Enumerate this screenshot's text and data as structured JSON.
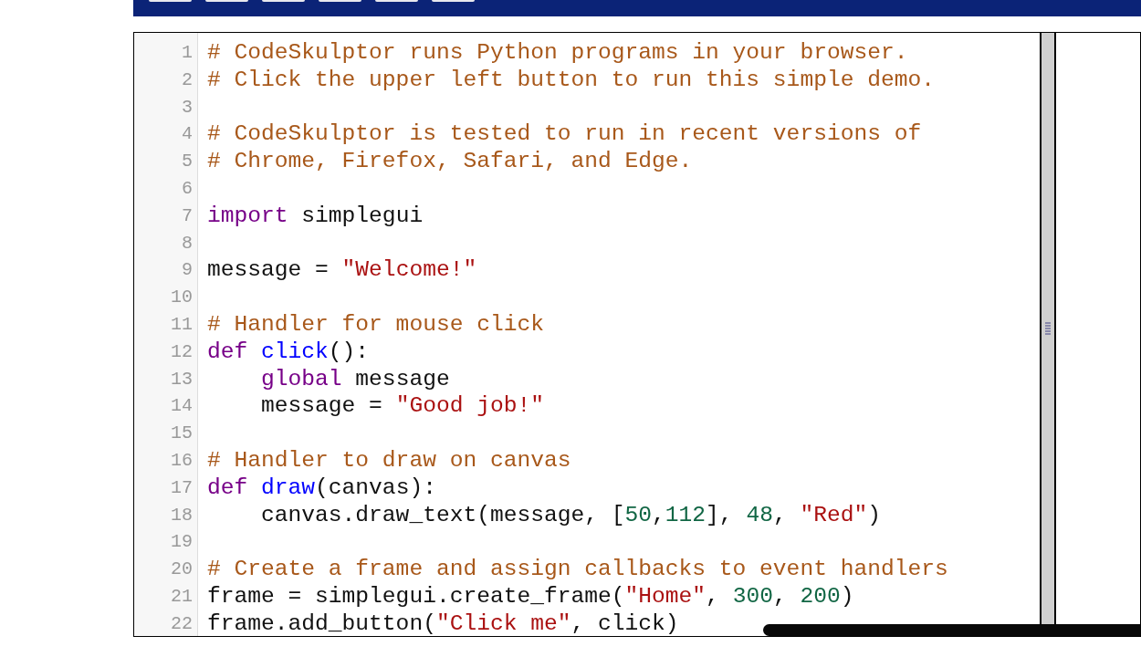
{
  "editor": {
    "lines": [
      {
        "n": "1",
        "tokens": [
          {
            "kind": "comment",
            "text": "# CodeSkulptor runs Python programs in your browser."
          }
        ]
      },
      {
        "n": "2",
        "tokens": [
          {
            "kind": "comment",
            "text": "# Click the upper left button to run this simple demo."
          }
        ]
      },
      {
        "n": "3"
      },
      {
        "n": "4",
        "tokens": [
          {
            "kind": "comment",
            "text": "# CodeSkulptor is tested to run in recent versions of"
          }
        ]
      },
      {
        "n": "5",
        "tokens": [
          {
            "kind": "comment",
            "text": "# Chrome, Firefox, Safari, and Edge."
          }
        ]
      },
      {
        "n": "6"
      },
      {
        "n": "7",
        "tokens": [
          {
            "kind": "keyword",
            "text": "import"
          },
          {
            "kind": "plain",
            "text": " simplegui"
          }
        ]
      },
      {
        "n": "8"
      },
      {
        "n": "9",
        "tokens": [
          {
            "kind": "plain",
            "text": "message = "
          },
          {
            "kind": "string",
            "text": "\"Welcome!\""
          }
        ]
      },
      {
        "n": "10"
      },
      {
        "n": "11",
        "tokens": [
          {
            "kind": "comment",
            "text": "# Handler for mouse click"
          }
        ]
      },
      {
        "n": "12",
        "tokens": [
          {
            "kind": "keyword",
            "text": "def"
          },
          {
            "kind": "def",
            "text": " click"
          },
          {
            "kind": "plain",
            "text": "():"
          }
        ]
      },
      {
        "n": "13",
        "indent": true,
        "tokens": [
          {
            "kind": "keyword",
            "text": "global"
          },
          {
            "kind": "plain",
            "text": " message"
          }
        ]
      },
      {
        "n": "14",
        "indent": true,
        "tokens": [
          {
            "kind": "plain",
            "text": "message = "
          },
          {
            "kind": "string",
            "text": "\"Good job!\""
          }
        ]
      },
      {
        "n": "15"
      },
      {
        "n": "16",
        "tokens": [
          {
            "kind": "comment",
            "text": "# Handler to draw on canvas"
          }
        ]
      },
      {
        "n": "17",
        "tokens": [
          {
            "kind": "keyword",
            "text": "def"
          },
          {
            "kind": "def",
            "text": " draw"
          },
          {
            "kind": "plain",
            "text": "(canvas):"
          }
        ]
      },
      {
        "n": "18",
        "indent": true,
        "tokens": [
          {
            "kind": "plain",
            "text": "canvas.draw_text(message, ["
          },
          {
            "kind": "number",
            "text": "50"
          },
          {
            "kind": "plain",
            "text": ","
          },
          {
            "kind": "number",
            "text": "112"
          },
          {
            "kind": "plain",
            "text": "], "
          },
          {
            "kind": "number",
            "text": "48"
          },
          {
            "kind": "plain",
            "text": ", "
          },
          {
            "kind": "string",
            "text": "\"Red\""
          },
          {
            "kind": "plain",
            "text": ")"
          }
        ]
      },
      {
        "n": "19"
      },
      {
        "n": "20",
        "tokens": [
          {
            "kind": "comment",
            "text": "# Create a frame and assign callbacks to event handlers"
          }
        ]
      },
      {
        "n": "21",
        "tokens": [
          {
            "kind": "plain",
            "text": "frame = simplegui.create_frame("
          },
          {
            "kind": "string",
            "text": "\"Home\""
          },
          {
            "kind": "plain",
            "text": ", "
          },
          {
            "kind": "number",
            "text": "300"
          },
          {
            "kind": "plain",
            "text": ", "
          },
          {
            "kind": "number",
            "text": "200"
          },
          {
            "kind": "plain",
            "text": ")"
          }
        ]
      },
      {
        "n": "22",
        "tokens": [
          {
            "kind": "plain",
            "text": "frame.add_button("
          },
          {
            "kind": "string",
            "text": "\"Click me\""
          },
          {
            "kind": "plain",
            "text": ", click)"
          }
        ]
      }
    ]
  }
}
